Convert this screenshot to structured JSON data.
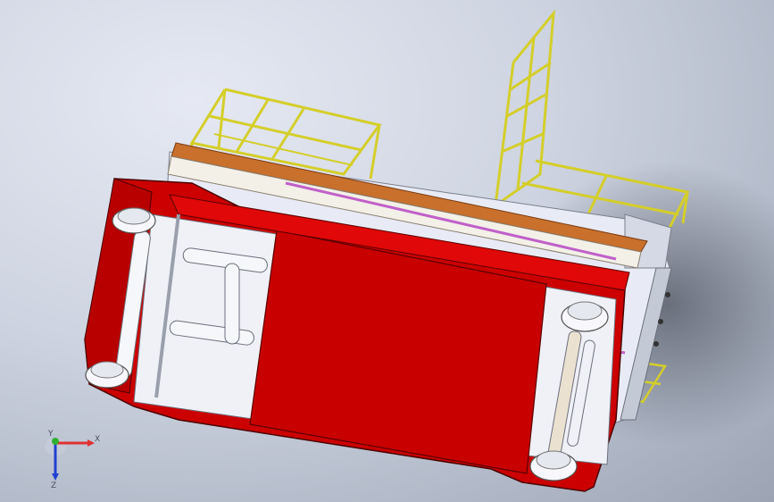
{
  "view": {
    "background_top": "#e6e9f3",
    "background_bottom": "#9ca4b4"
  },
  "model": {
    "body_color": "#cc0000",
    "rail_color": "#d4ce2a",
    "trim_color": "#c8702c",
    "frame_color": "#eef0f6",
    "accent_color": "#c060c8"
  },
  "triad": {
    "x_label": "X",
    "y_label": "Y",
    "z_label": "Z",
    "x_color": "#e03030",
    "y_color": "#30b030",
    "z_color": "#2040d0"
  }
}
